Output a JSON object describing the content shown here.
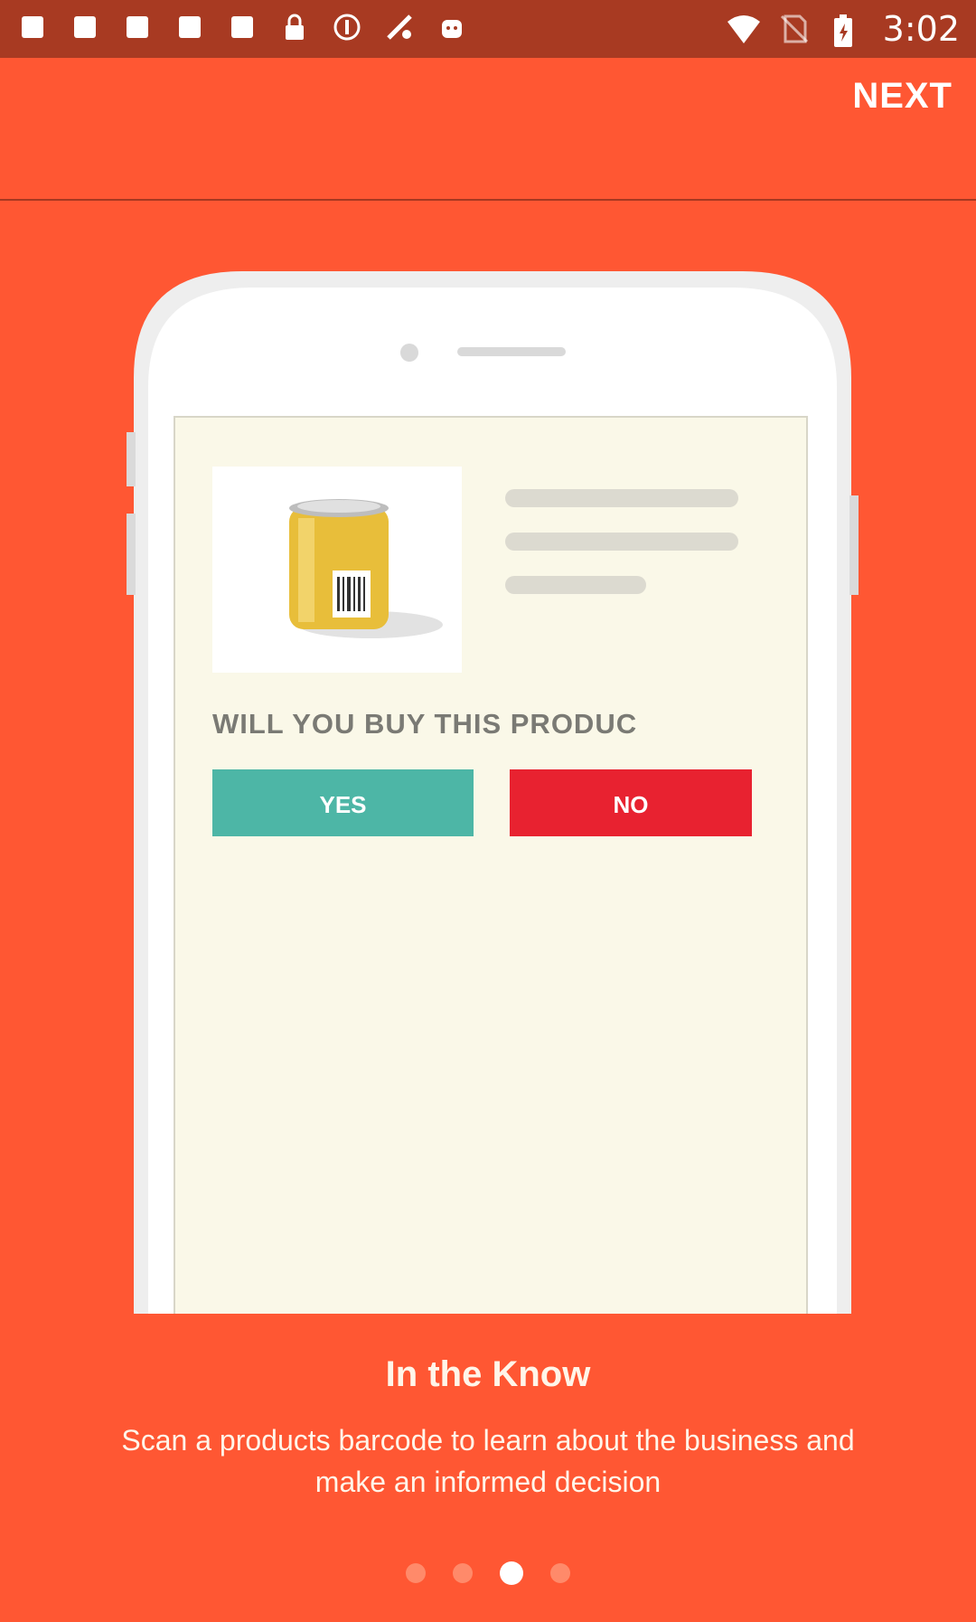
{
  "status_bar": {
    "time": "3:02",
    "left_icons": [
      "notification-icon",
      "notification-icon",
      "notification-icon",
      "notification-icon",
      "notification-icon",
      "lock-icon",
      "privacy-icon",
      "fake-gps-icon",
      "android-icon"
    ],
    "right_icons": [
      "wifi-icon",
      "no-sim-icon",
      "battery-charging-icon"
    ]
  },
  "appbar": {
    "next_label": "NEXT"
  },
  "onboarding": {
    "image": {
      "question": "WILL YOU BUY THIS PRODUC",
      "yes_label": "YES",
      "no_label": "NO",
      "colors": {
        "yes": "#4DB6A6",
        "no": "#E82230",
        "screen": "#FAF8E8"
      }
    },
    "title": "In the Know",
    "description": "Scan a products barcode to learn about the business and make an informed decision"
  },
  "page_indicator": {
    "total": 4,
    "active_index": 2
  },
  "colors": {
    "background": "#FF5733",
    "status_bar": "#A83A22"
  }
}
